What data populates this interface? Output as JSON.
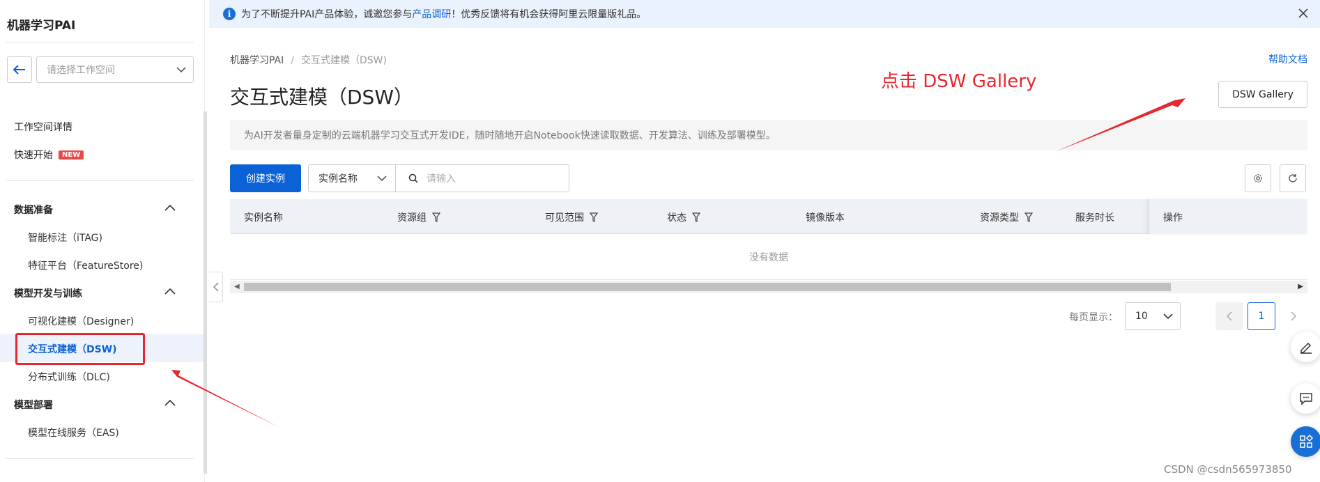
{
  "sidebar": {
    "title": "机器学习PAI",
    "workspace_placeholder": "请选择工作空间",
    "items": [
      {
        "label": "工作空间详情"
      },
      {
        "label": "快速开始",
        "badge": "NEW"
      }
    ],
    "groups": [
      {
        "label": "数据准备",
        "children": [
          "智能标注（iTAG)",
          "特征平台（FeatureStore)"
        ]
      },
      {
        "label": "模型开发与训练",
        "children": [
          "可视化建模（Designer)",
          "交互式建模（DSW)",
          "分布式训练（DLC)"
        ]
      },
      {
        "label": "模型部署",
        "children": [
          "模型在线服务（EAS)"
        ]
      }
    ],
    "active_item": "交互式建模（DSW)"
  },
  "notice": {
    "prefix": "为了不断提升PAI产品体验，诚邀您参与",
    "link": "产品调研",
    "suffix": "！优秀反馈将有机会获得阿里云限量版礼品。"
  },
  "breadcrumb": [
    "机器学习PAI",
    "交互式建模（DSW)"
  ],
  "help_link": "帮助文档",
  "page_title": "交互式建模（DSW）",
  "annotation": "点击 DSW Gallery",
  "gallery_button": "DSW Gallery",
  "description": "为AI开发者量身定制的云端机器学习交互式开发IDE，随时随地开启Notebook快速读取数据、开发算法、训练及部署模型。",
  "toolbar": {
    "create_label": "创建实例",
    "filter_field": "实例名称",
    "search_placeholder": "请输入"
  },
  "table": {
    "columns": [
      "实例名称",
      "资源组",
      "可见范围",
      "状态",
      "镜像版本",
      "资源类型",
      "服务时长",
      "操作"
    ],
    "empty_text": "没有数据"
  },
  "pagination": {
    "label": "每页显示：",
    "page_size": "10",
    "current_page": "1"
  },
  "watermark": "CSDN @csdn565973850",
  "colors": {
    "primary": "#0b61d6",
    "annotation": "#e8262d"
  }
}
